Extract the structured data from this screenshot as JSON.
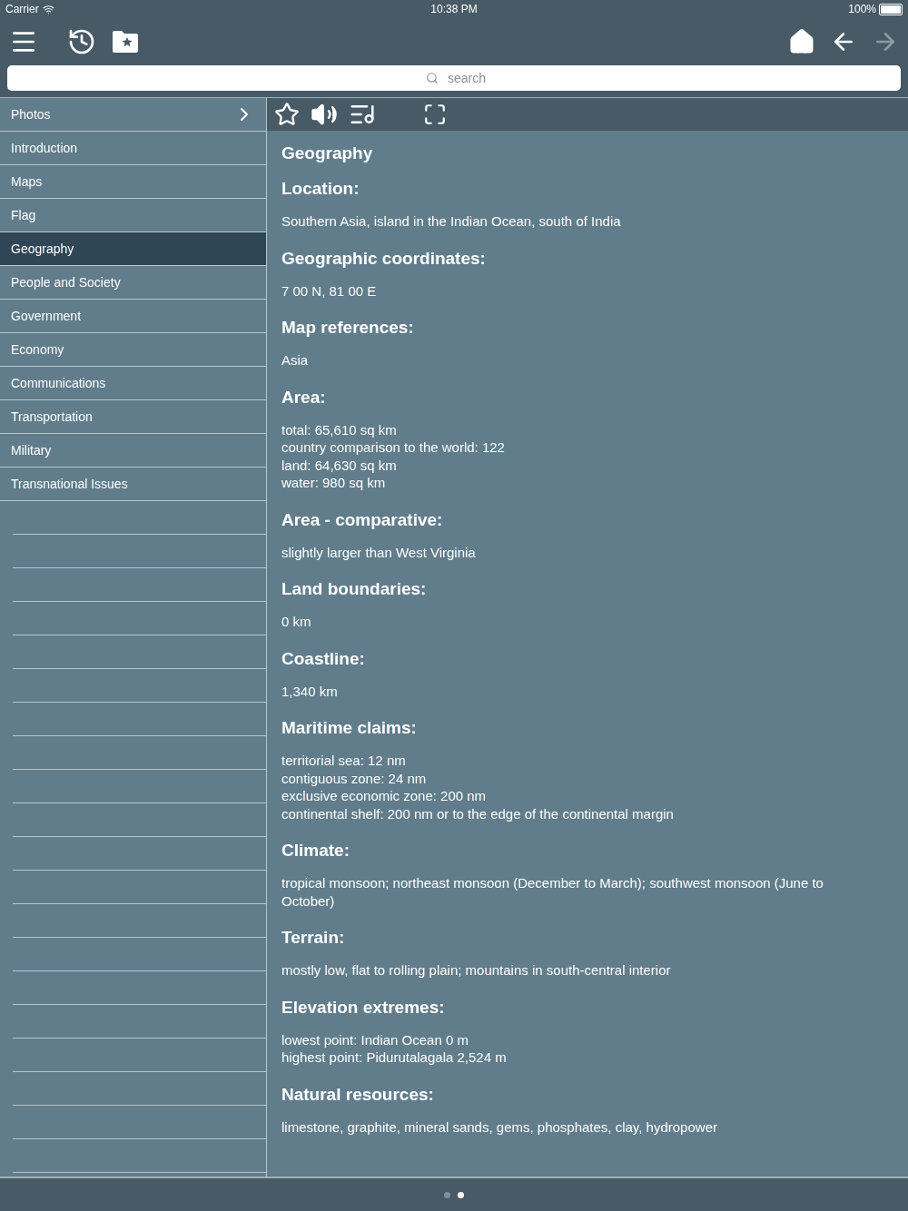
{
  "status_bar": {
    "carrier": "Carrier",
    "time": "10:38 PM",
    "battery": "100%"
  },
  "toolbar": {
    "forward_disabled": true,
    "back_disabled": false
  },
  "search": {
    "placeholder": "search"
  },
  "sidebar": {
    "items": [
      {
        "label": "Photos",
        "kind": "folder",
        "selected": false
      },
      {
        "label": "Introduction",
        "kind": "item",
        "selected": false
      },
      {
        "label": "Maps",
        "kind": "item",
        "selected": false
      },
      {
        "label": "Flag",
        "kind": "item",
        "selected": false
      },
      {
        "label": "Geography",
        "kind": "item",
        "selected": true
      },
      {
        "label": "People and Society",
        "kind": "item",
        "selected": false
      },
      {
        "label": "Government",
        "kind": "item",
        "selected": false
      },
      {
        "label": "Economy",
        "kind": "item",
        "selected": false
      },
      {
        "label": "Communications",
        "kind": "item",
        "selected": false
      },
      {
        "label": "Transportation",
        "kind": "item",
        "selected": false
      },
      {
        "label": "Military",
        "kind": "item",
        "selected": false
      },
      {
        "label": "Transnational Issues",
        "kind": "item",
        "selected": false
      }
    ]
  },
  "article": {
    "title": "Geography",
    "sections": [
      {
        "heading": "Location:",
        "lines": [
          "Southern Asia, island in the Indian Ocean, south of India"
        ]
      },
      {
        "heading": "Geographic coordinates:",
        "lines": [
          "7 00 N, 81 00 E"
        ]
      },
      {
        "heading": "Map references:",
        "lines": [
          "Asia"
        ]
      },
      {
        "heading": "Area:",
        "lines": [
          "total: 65,610 sq km",
          "country comparison to the world: 122",
          "land: 64,630 sq km",
          "water: 980 sq km"
        ]
      },
      {
        "heading": "Area - comparative:",
        "lines": [
          "slightly larger than West Virginia"
        ]
      },
      {
        "heading": "Land boundaries:",
        "lines": [
          "0 km"
        ]
      },
      {
        "heading": "Coastline:",
        "lines": [
          "1,340 km"
        ]
      },
      {
        "heading": "Maritime claims:",
        "lines": [
          "territorial sea: 12 nm",
          "contiguous zone: 24 nm",
          "exclusive economic zone: 200 nm",
          "continental shelf: 200 nm or to the edge of the continental margin"
        ]
      },
      {
        "heading": "Climate:",
        "lines": [
          "tropical monsoon; northeast monsoon (December to March); southwest monsoon (June to October)"
        ]
      },
      {
        "heading": "Terrain:",
        "lines": [
          "mostly low, flat to rolling plain; mountains in south-central interior"
        ]
      },
      {
        "heading": "Elevation extremes:",
        "lines": [
          "lowest point: Indian Ocean 0 m",
          "highest point: Pidurutalagala 2,524 m"
        ]
      },
      {
        "heading": "Natural resources:",
        "lines": [
          "limestone, graphite, mineral sands, gems, phosphates, clay, hydropower"
        ]
      }
    ]
  },
  "page_dots": [
    {
      "selected": false
    },
    {
      "selected": true
    }
  ]
}
